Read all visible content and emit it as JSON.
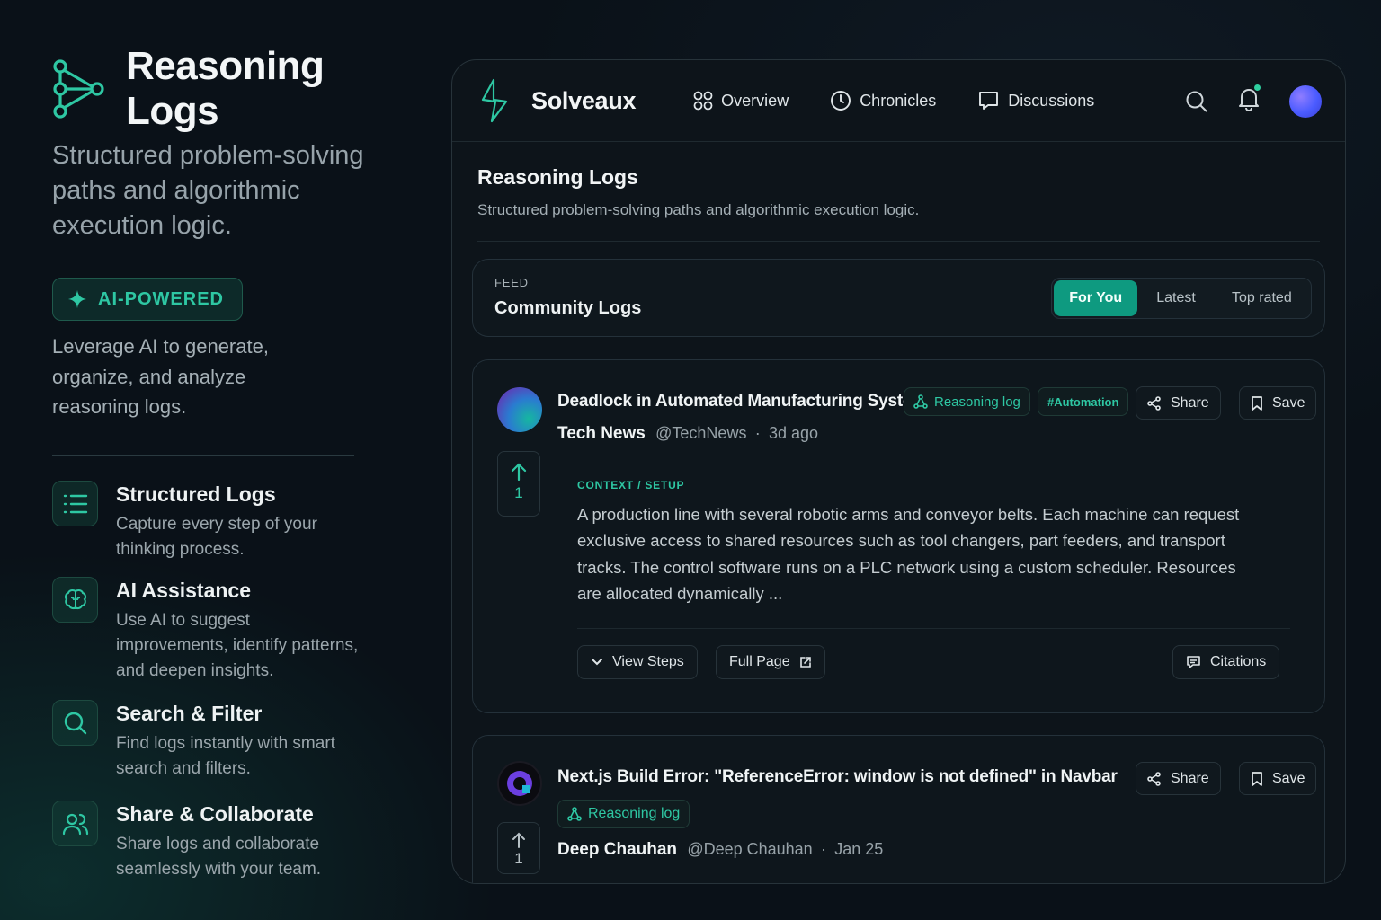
{
  "hero": {
    "title": "Reasoning Logs",
    "tagline": "Structured problem-solving paths and algorithmic execution logic.",
    "badge": "AI-POWERED",
    "description": "Leverage AI to generate, organize, and analyze reasoning logs."
  },
  "features": [
    {
      "title": "Structured Logs",
      "desc": "Capture every step of your thinking process.",
      "icon": "list-icon"
    },
    {
      "title": "AI Assistance",
      "desc": "Use AI to suggest improvements, identify patterns, and deepen insights.",
      "icon": "brain-icon"
    },
    {
      "title": "Search & Filter",
      "desc": "Find logs instantly with smart search and filters.",
      "icon": "search-icon"
    },
    {
      "title": "Share & Collaborate",
      "desc": "Share logs and collaborate seamlessly with your team.",
      "icon": "users-icon"
    }
  ],
  "app": {
    "name": "Solveaux",
    "nav": [
      {
        "label": "Overview",
        "icon": "grid-icon"
      },
      {
        "label": "Chronicles",
        "icon": "clock-icon"
      },
      {
        "label": "Discussions",
        "icon": "chat-icon"
      }
    ],
    "page_title": "Reasoning Logs",
    "page_subtitle": "Structured problem-solving paths and algorithmic execution logic.",
    "feed": {
      "label": "FEED",
      "title": "Community Logs",
      "tabs": [
        "For You",
        "Latest",
        "Top rated"
      ],
      "active_tab": "For You"
    }
  },
  "posts": [
    {
      "title": "Deadlock in Automated Manufacturing System",
      "tag": "Reasoning log",
      "hashtag": "#Automation",
      "author": "Tech News",
      "handle": "@TechNews",
      "time": "3d ago",
      "votes": "1",
      "context": "CONTEXT  /  SETUP",
      "body": "A production line with several robotic arms and conveyor belts. Each machine can request exclusive access to shared resources such as tool changers, part feeders, and transport tracks. The control software runs on a PLC network using a custom scheduler. Resources are allocated dynamically ...",
      "actions": {
        "share": "Share",
        "save": "Save",
        "view_steps": "View Steps",
        "full_page": "Full Page",
        "citations": "Citations"
      }
    },
    {
      "title": "Next.js Build Error: \"ReferenceError: window is not defined\" in Navbar",
      "tag": "Reasoning log",
      "author": "Deep Chauhan",
      "handle": "@Deep Chauhan",
      "time": "Jan 25",
      "votes": "1",
      "actions": {
        "share": "Share",
        "save": "Save"
      }
    }
  ],
  "colors": {
    "accent": "#0e9a80",
    "accent_text": "#2ec7a3",
    "background": "#0a1118",
    "panel": "#0d141a"
  }
}
